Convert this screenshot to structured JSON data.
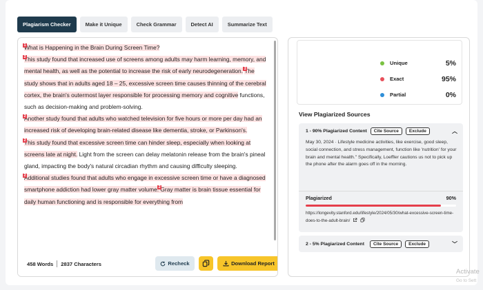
{
  "tabs": [
    {
      "label": "Plagiarism Checker",
      "active": true
    },
    {
      "label": "Make it Unique",
      "active": false
    },
    {
      "label": "Check Grammar",
      "active": false
    },
    {
      "label": "Detect AI",
      "active": false
    },
    {
      "label": "Summarize Text",
      "active": false
    }
  ],
  "editor": {
    "p1": {
      "m1": "1",
      "t1": "What is Happening in the Brain During Screen Time?"
    },
    "p2": {
      "m1": "2",
      "t1": "This study found that increased use of screens among adults may harm learning, memory, and mental health, as well as the potential to increase the risk of early neurodegeneration.",
      "m2": "2",
      "t2": "The study shows that in adults aged 18 – 25, excessive screen time causes thinning of the cerebral cortex, the brain's outermost layer responsible for processing memory and cognitive",
      "t3": " functions, such as decision-making and problem-solving."
    },
    "p3": {
      "m1": "2",
      "t1": "Another study found that adults who watched television for five hours or more per day had an increased risk of developing brain-related disease like dementia, stroke, or Parkinson's."
    },
    "p4": {
      "m1": "2",
      "t1": "This study found that excessive screen time can hinder sleep, especially when looking at screens late at night.",
      "t2": " Light from the screen can delay melatonin release from the brain's pineal gland, impacting the body's natural circadian rhythm and causing difficulty sleeping."
    },
    "p5": {
      "m1": "2",
      "t1": "Additional studies found that adults who engage in excessive screen time or have a diagnosed smartphone addiction had lower gray matter volume.",
      "m2": "2",
      "t2": " Gray matter is brain tissue essential for daily human functioning and is responsible for everything from"
    }
  },
  "footer": {
    "words": "458 Words",
    "chars": "2837 Characters",
    "recheck": "Recheck",
    "download": "Download Report"
  },
  "stats": [
    {
      "label": "Unique",
      "pct": "5%",
      "color": "#7ac142"
    },
    {
      "label": "Exact",
      "pct": "95%",
      "color": "#e8505b"
    },
    {
      "label": "Partial",
      "pct": "0%",
      "color": "#2f8fd8"
    }
  ],
  "sources": {
    "title": "View Plagiarized Sources",
    "items": [
      {
        "heading": "1 - 90% Plagiarized Content",
        "cite": "Cite Source",
        "exclude": "Exclude",
        "text": "May 30, 2024 · Lifestyle medicine activities, like exercise, good sleep, social connection, and stress management, function like 'nutrition' for your brain and mental health.\" Specifically, Loeffler cautions us not to pick up the phone after the alarm goes off in the morning.",
        "plag_label": "Plagiarized",
        "plag_pct": "90%",
        "plag_fraction": 0.9,
        "url": "https://longevity.stanford.edu/lifestyle/2024/05/30/what-excessive-screen-time-does-to-the-adult-brain/"
      },
      {
        "heading": "2 - 5% Plagiarized Content",
        "cite": "Cite Source",
        "exclude": "Exclude"
      }
    ]
  },
  "watermark": {
    "line1": "Activate",
    "line2": "Go to Sett"
  }
}
